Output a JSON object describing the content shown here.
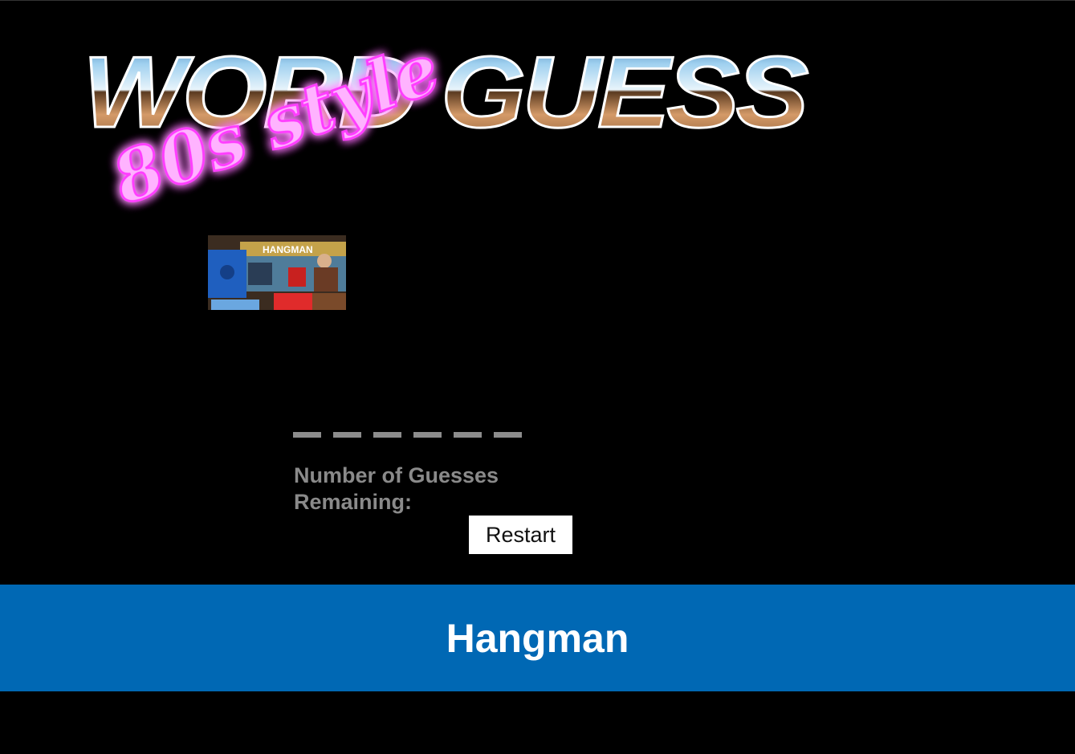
{
  "logo": {
    "main_text": "WORD GUESS",
    "sub_text": "80s style",
    "accent_color": "#ff4dff"
  },
  "thumbnail": {
    "box_title": "HANGMAN"
  },
  "game": {
    "blank_count": 6,
    "guesses_label": "Number of Guesses Remaining:",
    "guesses_value": "",
    "restart_label": "Restart"
  },
  "footer": {
    "title": "Hangman",
    "background_color": "#0068b4"
  }
}
